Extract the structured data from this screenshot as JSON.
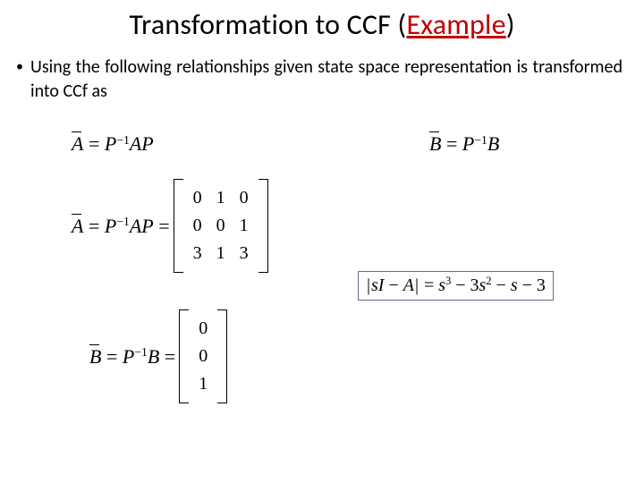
{
  "title": {
    "pre": "Transformation to CCF (",
    "example": "Example",
    "post": ")"
  },
  "bullet": "Using the following relationships given state space representation is transformed into CCf as",
  "eq_a_rel": {
    "lhs": "A",
    "rhs": "P⁻¹AP"
  },
  "eq_b_rel": {
    "lhs": "B",
    "rhs": "P⁻¹B"
  },
  "matrix_A": {
    "label_lhs": "A",
    "expr": "P⁻¹AP",
    "rows": [
      [
        "0",
        "1",
        "0"
      ],
      [
        "0",
        "0",
        "1"
      ],
      [
        "3",
        "1",
        "3"
      ]
    ]
  },
  "matrix_B": {
    "label_lhs": "B",
    "expr": "P⁻¹B",
    "rows": [
      [
        "0"
      ],
      [
        "0"
      ],
      [
        "1"
      ]
    ]
  },
  "char_poly": "|sI − A| = s³ − 3s² − s − 3"
}
